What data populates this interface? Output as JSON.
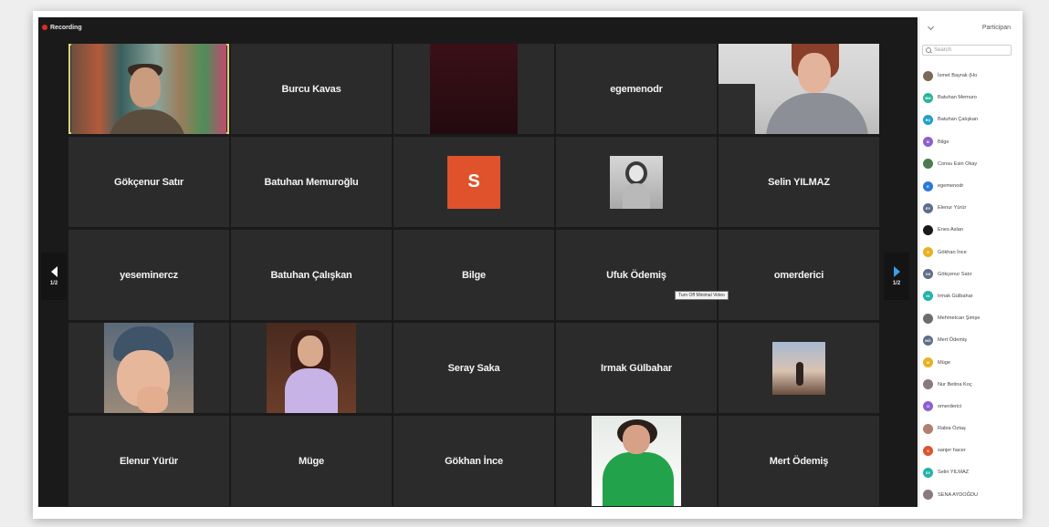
{
  "recording": {
    "label": "Recording"
  },
  "tiles": [
    {
      "name": "",
      "kind": "video-man"
    },
    {
      "name": "Burcu Kavas",
      "kind": "name"
    },
    {
      "name": "",
      "kind": "video-dark"
    },
    {
      "name": "egemenodr",
      "kind": "name"
    },
    {
      "name": "",
      "kind": "video-woman"
    },
    {
      "name": "Gökçenur Satır",
      "kind": "name"
    },
    {
      "name": "Batuhan Memuroğlu",
      "kind": "name"
    },
    {
      "name": "S",
      "kind": "initial"
    },
    {
      "name": "",
      "kind": "photo"
    },
    {
      "name": "Selin YILMAZ",
      "kind": "name"
    },
    {
      "name": "yeseminercz",
      "kind": "name"
    },
    {
      "name": "Batuhan Çalışkan",
      "kind": "name"
    },
    {
      "name": "Bilge",
      "kind": "name"
    },
    {
      "name": "Ufuk Ödemiş",
      "kind": "name"
    },
    {
      "name": "omerderici",
      "kind": "name"
    },
    {
      "name": "",
      "kind": "photo"
    },
    {
      "name": "",
      "kind": "photo"
    },
    {
      "name": "Seray Saka",
      "kind": "name"
    },
    {
      "name": "Irmak Gülbahar",
      "kind": "name"
    },
    {
      "name": "",
      "kind": "photo"
    },
    {
      "name": "Elenur Yürür",
      "kind": "name"
    },
    {
      "name": "Müge",
      "kind": "name"
    },
    {
      "name": "Gökhan İnce",
      "kind": "name"
    },
    {
      "name": "",
      "kind": "photo"
    },
    {
      "name": "Mert Ödemiş",
      "kind": "name"
    }
  ],
  "nav": {
    "left_page": "1/2",
    "right_page": "1/2"
  },
  "tooltip": "Turn Off Minimal Video",
  "panel": {
    "title": "Participan",
    "search_placeholder": "Search",
    "participants": [
      {
        "name": "İsmet Bayrak (Ho",
        "initials": "",
        "color": "#7a6a5a"
      },
      {
        "name": "Batuhan Memuro",
        "initials": "BM",
        "color": "#27b59a"
      },
      {
        "name": "Batuhan Çalışkan",
        "initials": "BÇ",
        "color": "#1e9fc7"
      },
      {
        "name": "Bilge",
        "initials": "B",
        "color": "#8e5fd0"
      },
      {
        "name": "Consu Esin Okay",
        "initials": "",
        "color": "#4f7a4f"
      },
      {
        "name": "egemenodr",
        "initials": "E",
        "color": "#2b78d9"
      },
      {
        "name": "Elenur Yürür",
        "initials": "EY",
        "color": "#5d6d8a"
      },
      {
        "name": "Enes Aslan",
        "initials": "",
        "color": "#1a1a1a"
      },
      {
        "name": "Gökhan İnce",
        "initials": "G",
        "color": "#e8b21f"
      },
      {
        "name": "Gökçenur Satır",
        "initials": "GS",
        "color": "#5d6d8a"
      },
      {
        "name": "Irmak Gülbahar",
        "initials": "IG",
        "color": "#23b3a6"
      },
      {
        "name": "Mehmetcan Şimşe",
        "initials": "",
        "color": "#6d6d6d"
      },
      {
        "name": "Mert Ödemiş",
        "initials": "MÖ",
        "color": "#5d6d8a"
      },
      {
        "name": "Müge",
        "initials": "M",
        "color": "#e8b21f"
      },
      {
        "name": "Nur Betina Koç",
        "initials": "",
        "color": "#8a7a7a"
      },
      {
        "name": "omerderici",
        "initials": "O",
        "color": "#8e5fd0"
      },
      {
        "name": "Rabia Öztaş",
        "initials": "",
        "color": "#b08070"
      },
      {
        "name": "sanjer hacer",
        "initials": "S",
        "color": "#e0522c"
      },
      {
        "name": "Selin YILMAZ",
        "initials": "SY",
        "color": "#23b3a6"
      },
      {
        "name": "SENA AYDOĞDU",
        "initials": "",
        "color": "#8a7a7a"
      }
    ]
  },
  "colors": {
    "accent": "#3aa0e8",
    "recording": "#e02a2a",
    "tile_bg": "#2b2b2b"
  }
}
